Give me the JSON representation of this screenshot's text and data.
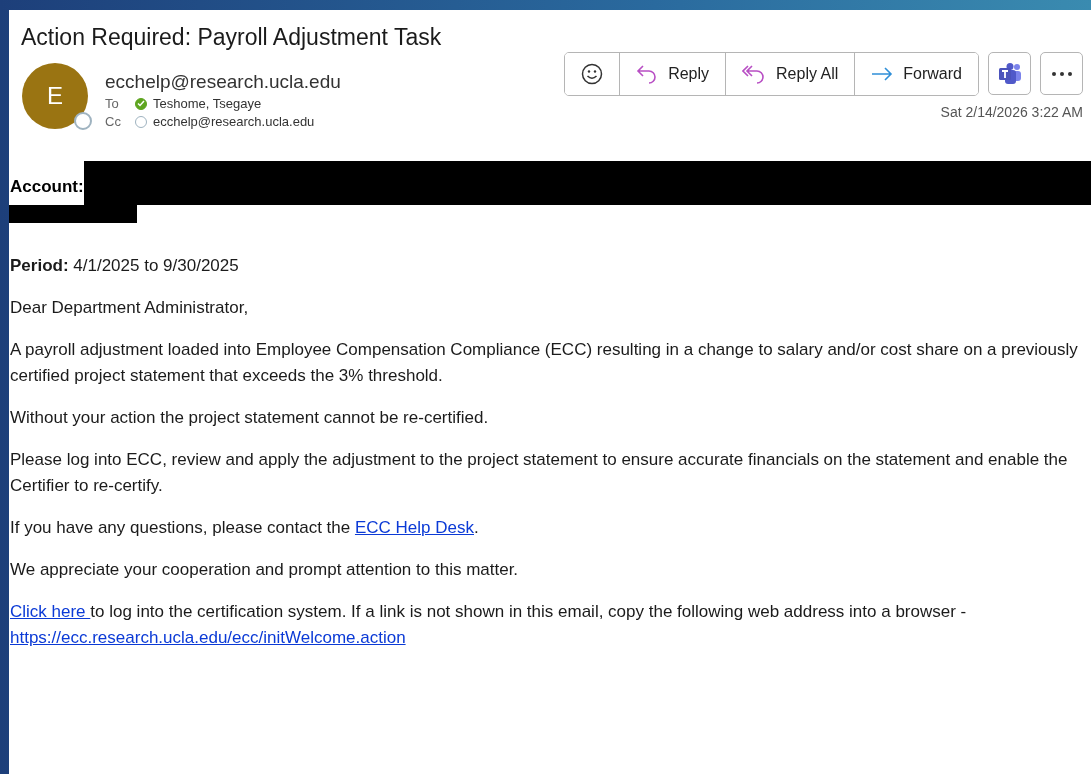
{
  "email": {
    "subject": "Action Required: Payroll Adjustment Task",
    "sender": {
      "initial": "E",
      "address": "ecchelp@research.ucla.edu",
      "available": false
    },
    "recipients": [
      {
        "label": "To",
        "name": "Teshome, Tsegaye",
        "available": true
      },
      {
        "label": "Cc",
        "name": "ecchelp@research.ucla.edu",
        "available": false
      }
    ],
    "actions": [
      {
        "kind": "react"
      },
      {
        "kind": "reply",
        "label": "Reply"
      },
      {
        "kind": "reply_all",
        "label": "Reply All"
      },
      {
        "kind": "forward",
        "label": "Forward"
      }
    ],
    "extra_actions": [
      {
        "kind": "teams"
      },
      {
        "kind": "more"
      }
    ],
    "date": "Sat 2/14/2026 3:22 AM"
  },
  "body": {
    "account_label": "Account:",
    "paragraphs": [
      [
        {
          "kind": "text",
          "text": "**Period:** 4/1/2025 to 9/30/2025"
        }
      ],
      [
        {
          "kind": "text",
          "text": "Dear Department Administrator,"
        }
      ],
      [
        {
          "kind": "text",
          "text": "A payroll adjustment loaded into Employee Compensation Compliance (ECC) resulting in a change to salary and/or cost share on a previously certified project statement that exceeds the 3% threshold."
        }
      ],
      [
        {
          "kind": "text",
          "text": "Without your action the project statement cannot be re-certified."
        }
      ],
      [
        {
          "kind": "text",
          "text": "Please log into ECC, review and apply the adjustment to the project statement to ensure accurate financials on the statement and enable the Certifier to re-certify."
        }
      ],
      [
        {
          "kind": "text",
          "text": "If you have any questions, please contact the "
        },
        {
          "kind": "link",
          "text": "ECC Help Desk"
        },
        {
          "kind": "text",
          "text": "."
        }
      ],
      [
        {
          "kind": "text",
          "text": "We appreciate your cooperation and prompt attention to this matter."
        }
      ],
      [
        {
          "kind": "link",
          "text": "Click here "
        },
        {
          "kind": "text",
          "text": "to log into the certification system. If a link is not shown in this email, copy the following web address into a browser - "
        },
        {
          "kind": "link",
          "text": "https://ecc.research.ucla.edu/ecc/initWelcome.action"
        }
      ]
    ]
  }
}
